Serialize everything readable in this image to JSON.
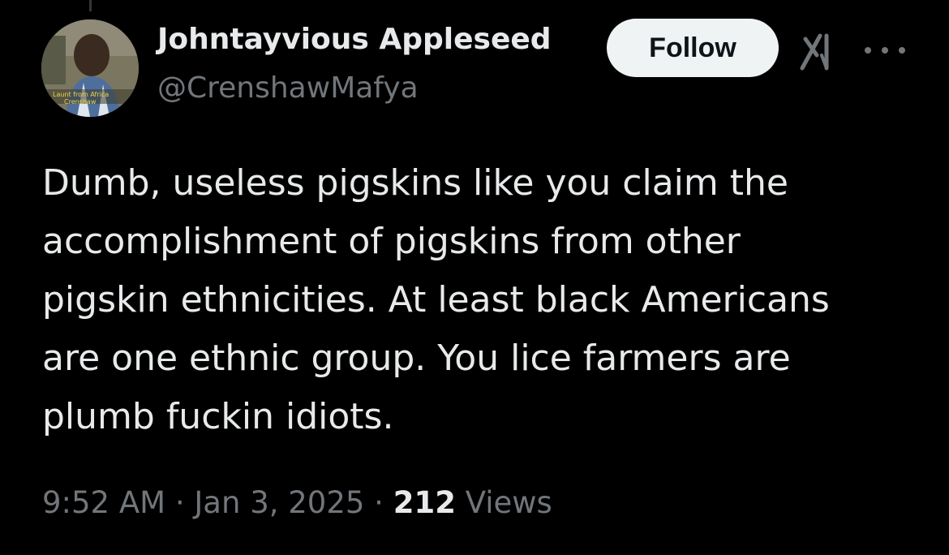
{
  "author": {
    "name": "Johntayvious Appleseed",
    "handle": "@CrenshawMafya",
    "avatar_caption": "Launt from Africa Crenshaw"
  },
  "actions": {
    "follow_label": "Follow",
    "grok_icon": "grok-icon",
    "more_icon": "more-options-icon"
  },
  "tweet": {
    "text": "Dumb, useless pigskins like you claim the\naccomplishment of pigskins from other\npigskin ethnicities. At least black Americans\nare one ethnic group. You lice farmers are\nplumb fuckin idiots."
  },
  "meta": {
    "time": "9:52 AM",
    "separator": " · ",
    "date": "Jan 3, 2025",
    "views_count": "212",
    "views_label": " Views"
  },
  "colors": {
    "background": "#000000",
    "primary_text": "#e7e9ea",
    "secondary_text": "#71767b",
    "follow_bg": "#eff3f4",
    "follow_text": "#0f1419"
  }
}
